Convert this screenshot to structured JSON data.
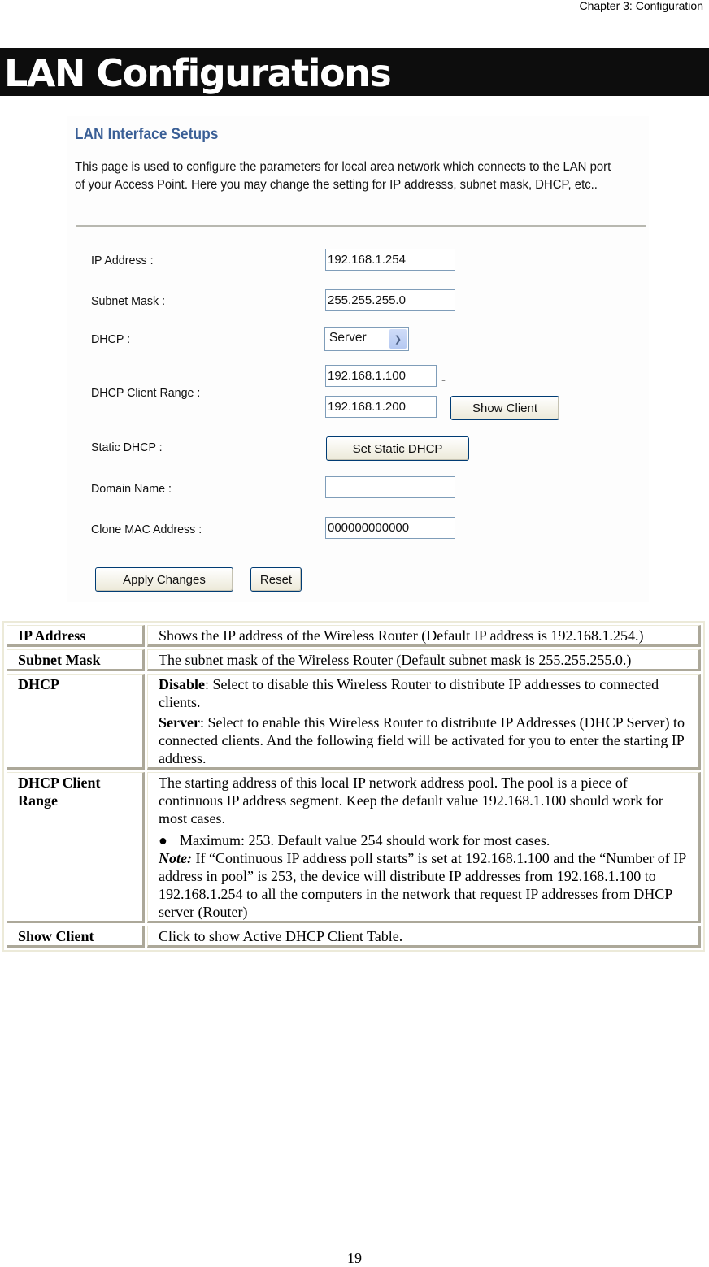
{
  "page": {
    "chapter_header": "Chapter 3: Configuration",
    "title": "LAN Configurations",
    "page_number": "19"
  },
  "screenshot": {
    "title": "LAN Interface Setups",
    "description": "This page is used to configure the parameters for local area network which connects to the LAN port of your Access Point. Here you may change the setting for IP addresss, subnet mask, DHCP, etc..",
    "fields": {
      "ip_address": {
        "label": "IP Address :",
        "value": "192.168.1.254"
      },
      "subnet_mask": {
        "label": "Subnet Mask :",
        "value": "255.255.255.0"
      },
      "dhcp": {
        "label": "DHCP :",
        "value": "Server"
      },
      "dhcp_client_range": {
        "label": "DHCP Client Range :",
        "start": "192.168.1.100",
        "separator": "-",
        "end": "192.168.1.200"
      },
      "static_dhcp": {
        "label": "Static DHCP :"
      },
      "domain_name": {
        "label": "Domain Name :",
        "value": ""
      },
      "clone_mac": {
        "label": "Clone MAC Address :",
        "value": "000000000000"
      }
    },
    "buttons": {
      "show_client": "Show Client",
      "set_static_dhcp": "Set Static DHCP",
      "apply_changes": "Apply Changes",
      "reset": "Reset"
    }
  },
  "table": {
    "rows": [
      {
        "term": "IP Address",
        "desc": "Shows the IP address of the Wireless Router (Default IP address is 192.168.1.254.)"
      },
      {
        "term": "Subnet Mask",
        "desc": "The subnet mask of the Wireless Router (Default subnet mask is 255.255.255.0.)"
      },
      {
        "term": "DHCP",
        "disable_label": "Disable",
        "disable_text": ": Select to disable this Wireless Router to distribute IP addresses to connected clients.",
        "server_label": "Server",
        "server_text": ": Select to enable this Wireless Router to distribute IP Addresses (DHCP Server) to connected clients. And the following field will be activated for you to enter the starting IP address."
      },
      {
        "term": "DHCP Client Range",
        "desc": "The starting address of this local IP network address pool. The pool is a piece of continuous IP address segment. Keep the default value 192.168.1.100 should work for most cases.",
        "bullet": "Maximum: 253.  Default value 254 should work for most cases.",
        "note_label": "Note:",
        "note_text": " If “Continuous IP address poll starts” is set at 192.168.1.100 and the “Number of IP address in pool” is 253, the device will distribute IP addresses from 192.168.1.100 to 192.168.1.254 to all the computers in the network that request IP addresses from DHCP server (Router)"
      },
      {
        "term": "Show Client",
        "desc": "Click to show Active DHCP Client Table."
      }
    ]
  }
}
